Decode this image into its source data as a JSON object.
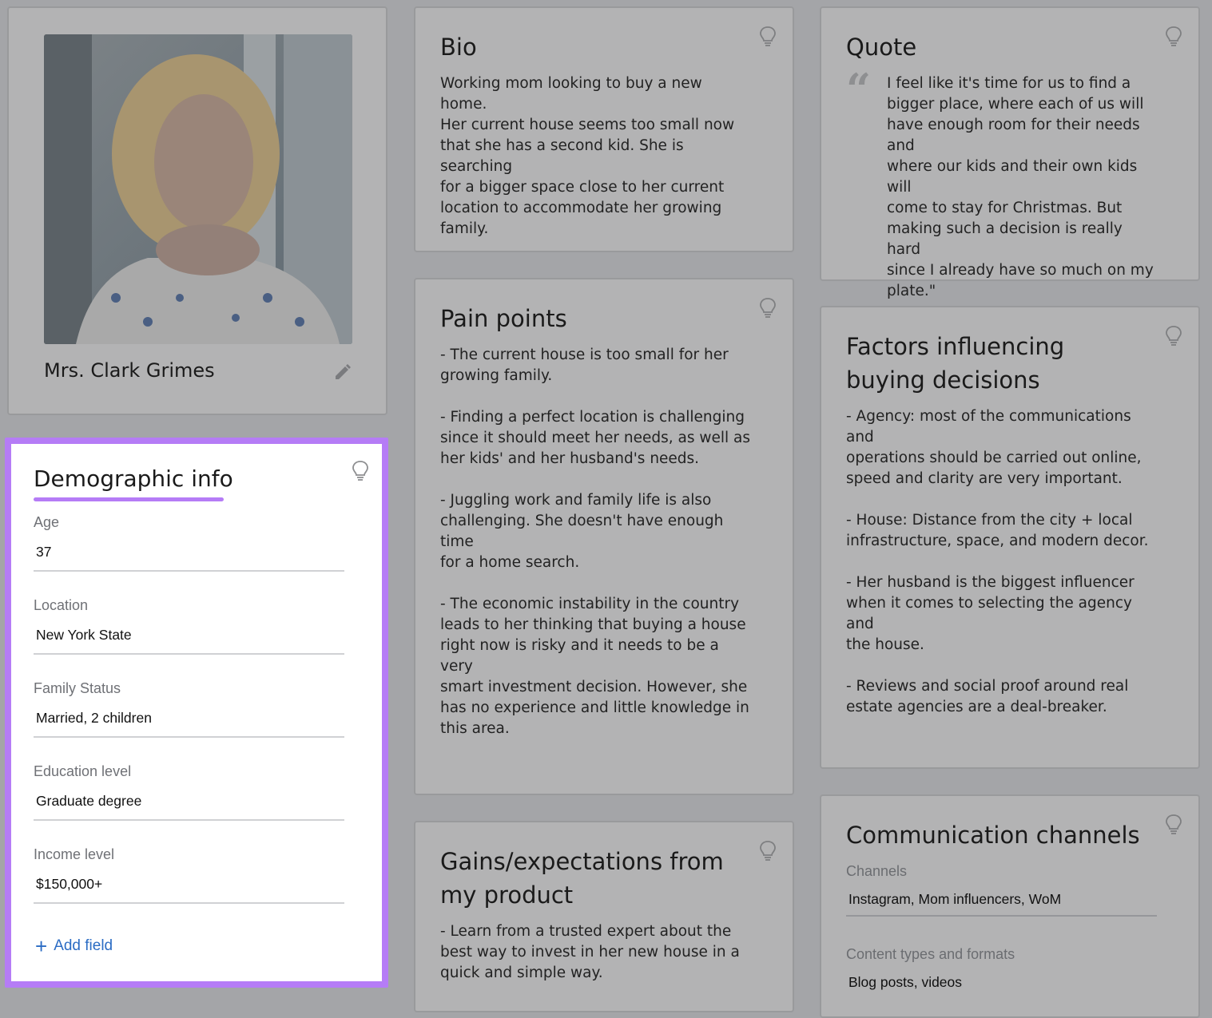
{
  "profile": {
    "name": "Mrs. Clark Grimes"
  },
  "demographic": {
    "title": "Demographic info",
    "fields": [
      {
        "label": "Age",
        "value": "37"
      },
      {
        "label": "Location",
        "value": "New York State"
      },
      {
        "label": "Family Status",
        "value": "Married, 2 children"
      },
      {
        "label": "Education level",
        "value": "Graduate degree"
      },
      {
        "label": "Income level",
        "value": "$150,000+"
      }
    ],
    "add_field_label": "Add field"
  },
  "bio": {
    "title": "Bio",
    "text": "Working mom looking to buy a new home.\nHer current house seems too small now\nthat she has a second kid. She is searching\nfor a bigger space close to her current\nlocation to accommodate her growing\nfamily."
  },
  "quote": {
    "title": "Quote",
    "text": "I feel like it's time for us to find a\nbigger place, where each of us will\nhave enough room for their needs and\nwhere our kids and their own kids will\ncome to stay for Christmas. But\nmaking such a decision is really hard\nsince I already have so much on my\nplate.\""
  },
  "pain_points": {
    "title": "Pain points",
    "text": "- The current house is too small for her\ngrowing family.\n\n- Finding a perfect location is challenging\nsince it should meet her needs, as well as\nher kids' and her husband's needs.\n\n- Juggling work and family life is also\nchallenging. She doesn't have enough time\nfor a home search.\n\n- The economic instability in the country\nleads to her thinking that buying a house\nright now is risky and it needs to be a very\nsmart investment decision. However, she\nhas no experience and little knowledge in\nthis area."
  },
  "factors": {
    "title": "Factors influencing buying decisions",
    "text": "- Agency: most of the communications and\noperations should be carried out online,\nspeed and clarity are very important.\n\n- House: Distance from the city + local\ninfrastructure, space, and modern decor.\n\n- Her husband is the biggest influencer\nwhen it comes to selecting the agency and\nthe house.\n\n- Reviews and social proof around real\nestate agencies are a deal-breaker."
  },
  "gains": {
    "title": "Gains/expectations from my product",
    "text": "- Learn from a trusted expert about the\nbest way to invest in her new house in a\nquick and simple way."
  },
  "communication": {
    "title": "Communication channels",
    "fields": [
      {
        "label": "Channels",
        "value": "Instagram, Mom influencers, WoM"
      },
      {
        "label": "Content types and formats",
        "value": "Blog posts, videos"
      }
    ]
  },
  "colors": {
    "overlay": "#a4a5a8",
    "highlight": "#b57cf6",
    "link": "#2b6cc4"
  },
  "icons": [
    "lightbulb-icon",
    "pencil-icon",
    "plus-icon",
    "quote-mark-icon"
  ]
}
